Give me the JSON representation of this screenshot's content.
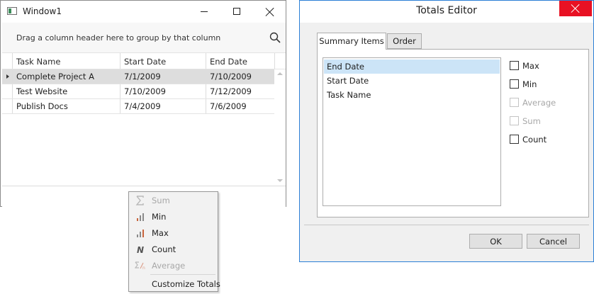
{
  "window1": {
    "title": "Window1",
    "group_panel_hint": "Drag a column header here to group by that column",
    "columns": [
      "Task Name",
      "Start Date",
      "End Date"
    ],
    "rows": [
      {
        "task": "Complete Project A",
        "start": "7/1/2009",
        "end": "7/10/2009",
        "selected": true
      },
      {
        "task": "Test Website",
        "start": "7/10/2009",
        "end": "7/12/2009",
        "selected": false
      },
      {
        "task": "Publish Docs",
        "start": "7/4/2009",
        "end": "7/6/2009",
        "selected": false
      }
    ]
  },
  "context_menu": {
    "items": [
      {
        "label": "Sum",
        "icon": "sum-icon",
        "enabled": false
      },
      {
        "label": "Min",
        "icon": "min-icon",
        "enabled": true
      },
      {
        "label": "Max",
        "icon": "max-icon",
        "enabled": true
      },
      {
        "label": "Count",
        "icon": "count-icon",
        "enabled": true
      },
      {
        "label": "Average",
        "icon": "average-icon",
        "enabled": false
      },
      {
        "label": "Customize Totals",
        "icon": "",
        "enabled": true
      }
    ]
  },
  "totals_editor": {
    "title": "Totals Editor",
    "tabs": [
      "Summary Items",
      "Order"
    ],
    "active_tab": "Summary Items",
    "summary_items": [
      {
        "label": "End Date",
        "selected": true
      },
      {
        "label": "Start Date",
        "selected": false
      },
      {
        "label": "Task Name",
        "selected": false
      }
    ],
    "options": [
      {
        "label": "Max",
        "enabled": true,
        "checked": false
      },
      {
        "label": "Min",
        "enabled": true,
        "checked": false
      },
      {
        "label": "Average",
        "enabled": false,
        "checked": false
      },
      {
        "label": "Sum",
        "enabled": false,
        "checked": false
      },
      {
        "label": "Count",
        "enabled": true,
        "checked": false
      }
    ],
    "ok_label": "OK",
    "cancel_label": "Cancel"
  },
  "colors": {
    "accent_border": "#2b7fd6",
    "close_red": "#e81123",
    "list_selection": "#cce4f7",
    "row_selection": "#dddddd",
    "chart_icon_orange": "#c8643c"
  }
}
